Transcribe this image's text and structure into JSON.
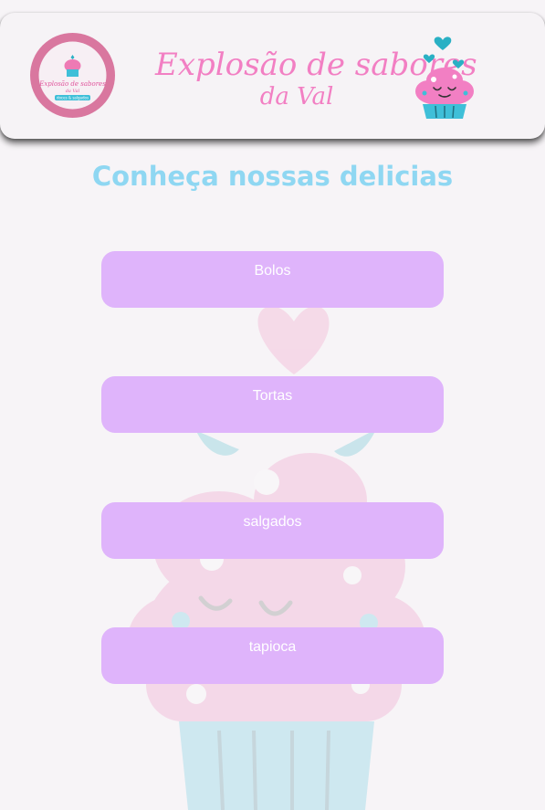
{
  "header": {
    "logo": {
      "text_top": "Explosão de sabores",
      "text_sub": "da Val",
      "text_tag": "doces & salgados"
    },
    "brand": {
      "line1": "Explosão de sabores",
      "line2": "da Val"
    }
  },
  "main": {
    "title": "Conheça nossas delicias",
    "buttons": [
      {
        "label": "Bolos"
      },
      {
        "label": "Tortas"
      },
      {
        "label": "salgados"
      },
      {
        "label": "tapioca"
      }
    ]
  },
  "colors": {
    "page_background": "#f7f4f7",
    "header_background": "#f6f3f6",
    "title": "#8fd7f2",
    "button_background": "#dfb4fb",
    "button_text": "#ffffff",
    "brand_pink": "#f27fc3",
    "logo_ring": "#d9779f",
    "cupcake_frosting": "#f2a1c9",
    "cupcake_liner": "#3fbfd8",
    "heart": "#2ab0c4"
  }
}
